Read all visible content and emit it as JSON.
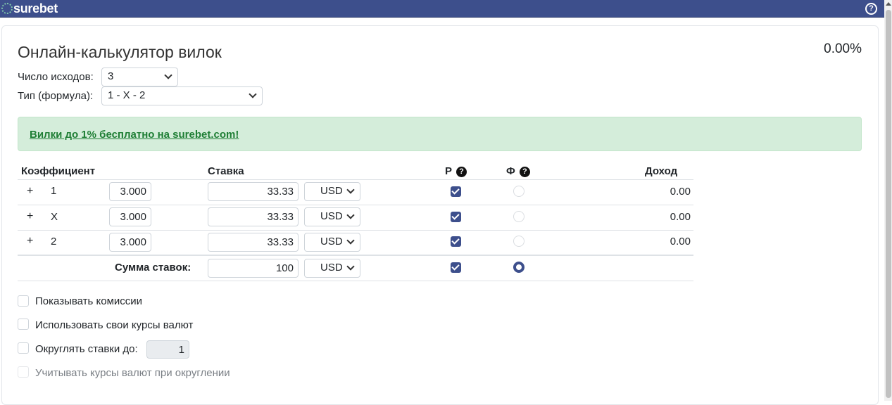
{
  "header": {
    "brand": "surebet"
  },
  "main": {
    "title": "Онлайн-калькулятор вилок",
    "profit_percent": "0.00%",
    "outcomes_label": "Число исходов:",
    "outcomes_value": "3",
    "type_label": "Тип (формула):",
    "type_value": "1 - X - 2",
    "promo_link": "Вилки до 1% бесплатно на surebet.com!"
  },
  "table": {
    "headers": {
      "coef": "Коэффициент",
      "stake": "Ставка",
      "r": "Р",
      "f": "Ф",
      "income": "Доход"
    },
    "rows": [
      {
        "plus": "+",
        "outcome": "1",
        "odds": "3.000",
        "stake": "33.33",
        "currency": "USD",
        "income": "0.00"
      },
      {
        "plus": "+",
        "outcome": "X",
        "odds": "3.000",
        "stake": "33.33",
        "currency": "USD",
        "income": "0.00"
      },
      {
        "plus": "+",
        "outcome": "2",
        "odds": "3.000",
        "stake": "33.33",
        "currency": "USD",
        "income": "0.00"
      }
    ],
    "total": {
      "label": "Сумма ставок:",
      "stake": "100",
      "currency": "USD"
    }
  },
  "options": {
    "show_commissions": "Показывать комиссии",
    "own_rates": "Использовать свои курсы валют",
    "round_stakes": "Округлять ставки до:",
    "round_value": "1",
    "consider_rates": "Учитывать курсы валют при округлении"
  },
  "colors": {
    "topbar": "#3d4f8c",
    "accent": "#3d4f8c",
    "alert_bg": "#d4edda",
    "alert_link": "#1e7e34"
  }
}
